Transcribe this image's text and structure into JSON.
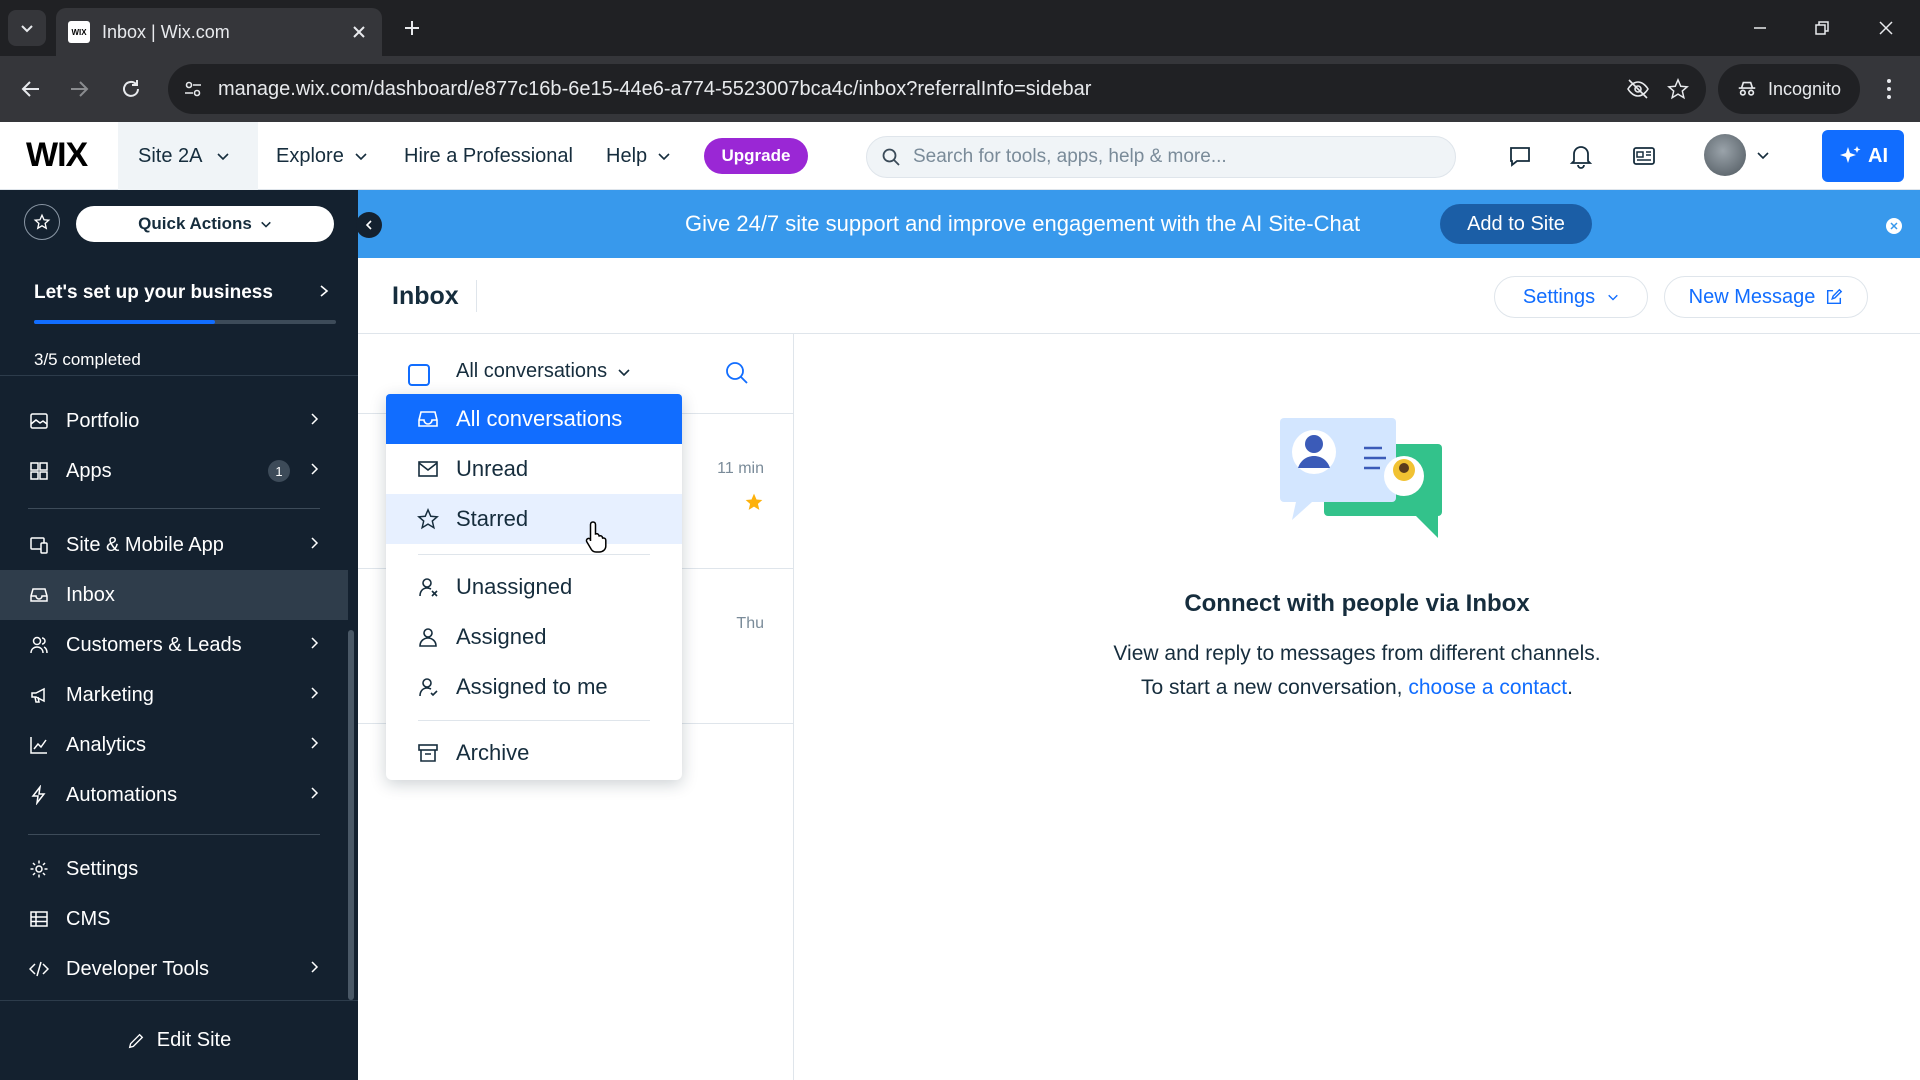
{
  "browser": {
    "tab_title": "Inbox | Wix.com",
    "favicon_text": "WIX",
    "url": "manage.wix.com/dashboard/e877c16b-6e15-44e6-a774-5523007bca4c/inbox?referralInfo=sidebar",
    "incognito_label": "Incognito"
  },
  "topbar": {
    "logo": "WIX",
    "site_name": "Site 2A",
    "nav": [
      {
        "label": "Explore"
      },
      {
        "label": "Hire a Professional"
      },
      {
        "label": "Help"
      }
    ],
    "upgrade_label": "Upgrade",
    "search_placeholder": "Search for tools, apps, help & more...",
    "ai_label": "AI"
  },
  "sidebar": {
    "quick_actions_label": "Quick Actions",
    "setup_title": "Let's set up your business",
    "setup_progress": 0.6,
    "setup_count": "3/5 completed",
    "items": [
      {
        "label": "Portfolio",
        "icon": "portfolio-icon"
      },
      {
        "label": "Apps",
        "icon": "apps-icon",
        "badge": "1"
      },
      {
        "label": "Site & Mobile App",
        "icon": "site-mobile-icon"
      },
      {
        "label": "Inbox",
        "icon": "inbox-icon",
        "active": true
      },
      {
        "label": "Customers & Leads",
        "icon": "customers-icon"
      },
      {
        "label": "Marketing",
        "icon": "megaphone-icon"
      },
      {
        "label": "Analytics",
        "icon": "analytics-icon"
      },
      {
        "label": "Automations",
        "icon": "lightning-icon"
      },
      {
        "label": "Settings",
        "icon": "gear-icon"
      },
      {
        "label": "CMS",
        "icon": "cms-icon"
      },
      {
        "label": "Developer Tools",
        "icon": "code-icon"
      }
    ],
    "edit_site_label": "Edit Site"
  },
  "banner": {
    "text": "Give 24/7 site support and improve engagement with the AI Site-Chat",
    "button_label": "Add to Site"
  },
  "inbox": {
    "title": "Inbox",
    "settings_label": "Settings",
    "new_message_label": "New Message",
    "filter_value": "All conversations",
    "conversations": [
      {
        "time": "11 min",
        "starred": true
      },
      {
        "time": "Thu",
        "starred": false
      }
    ]
  },
  "dropdown": {
    "items": [
      {
        "label": "All conversations",
        "icon": "inbox-tray-icon",
        "selected": true
      },
      {
        "label": "Unread",
        "icon": "envelope-icon"
      },
      {
        "label": "Starred",
        "icon": "star-icon",
        "hover": true
      },
      {
        "label": "Unassigned",
        "icon": "user-unassigned-icon"
      },
      {
        "label": "Assigned",
        "icon": "user-assigned-icon"
      },
      {
        "label": "Assigned to me",
        "icon": "user-me-icon"
      },
      {
        "label": "Archive",
        "icon": "archive-icon"
      }
    ]
  },
  "empty_state": {
    "title": "Connect with people via Inbox",
    "line1": "View and reply to messages from different channels.",
    "line2_prefix": "To start a new conversation, ",
    "line2_link": "choose a contact",
    "line2_suffix": "."
  },
  "colors": {
    "accent": "#116dff",
    "sidebar_bg": "#14212f",
    "banner_bg": "#3899ec",
    "upgrade": "#9a27d5",
    "star": "#fdb10c"
  }
}
